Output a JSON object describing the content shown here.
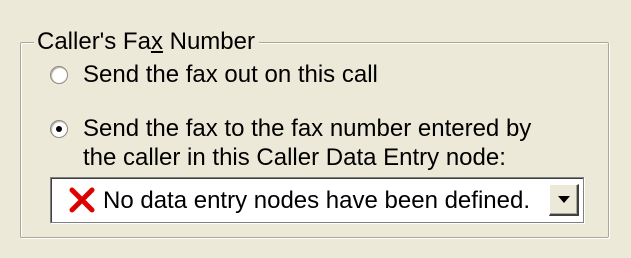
{
  "group": {
    "title_before": "Caller's Fa",
    "title_access_key": "x",
    "title_after": " Number"
  },
  "options": [
    {
      "label": "Send the fax out on this call",
      "checked": false
    },
    {
      "label": "Send the fax to the fax number entered by the caller in this Caller Data Entry node:",
      "checked": true
    }
  ],
  "combo": {
    "icon": "error-x-icon",
    "icon_color": "#e00000",
    "selected_text": "No data entry nodes have been defined."
  }
}
